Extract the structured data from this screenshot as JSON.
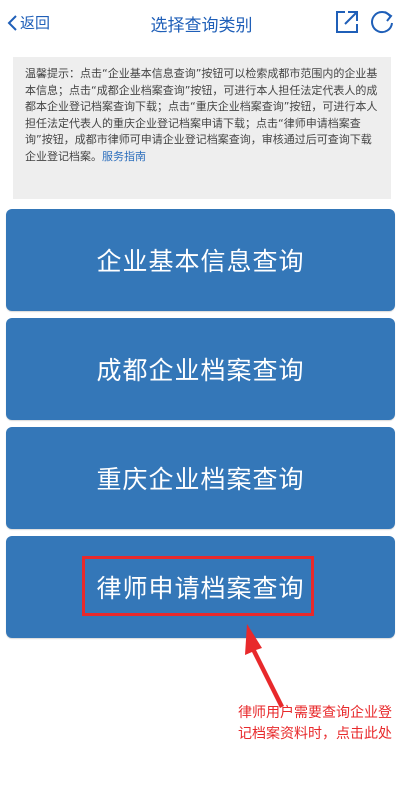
{
  "header": {
    "back_label": "返回",
    "title": "选择查询类别"
  },
  "notice": {
    "text": "温馨提示：点击“企业基本信息查询”按钮可以检索成都市范围内的企业基本信息；点击“成都企业档案查询”按钮，可进行本人担任法定代表人的成都本企业登记档案查询下载；点击“重庆企业档案查询”按钮，可进行本人担任法定代表人的重庆企业登记档案申请下载；点击“律师申请档案查询”按钮，成都市律师可申请企业登记档案查询，审核通过后可查询下载企业登记档案。",
    "link": "服务指南"
  },
  "buttons": [
    {
      "label": "企业基本信息查询"
    },
    {
      "label": "成都企业档案查询"
    },
    {
      "label": "重庆企业档案查询"
    },
    {
      "label": "律师申请档案查询"
    }
  ],
  "annotation": {
    "text": "律师用户需要查询企业登记档案资料时，点击此处"
  },
  "colors": {
    "accent": "#1f5fb8",
    "button": "#3477b8",
    "annotation": "#e8292b"
  }
}
